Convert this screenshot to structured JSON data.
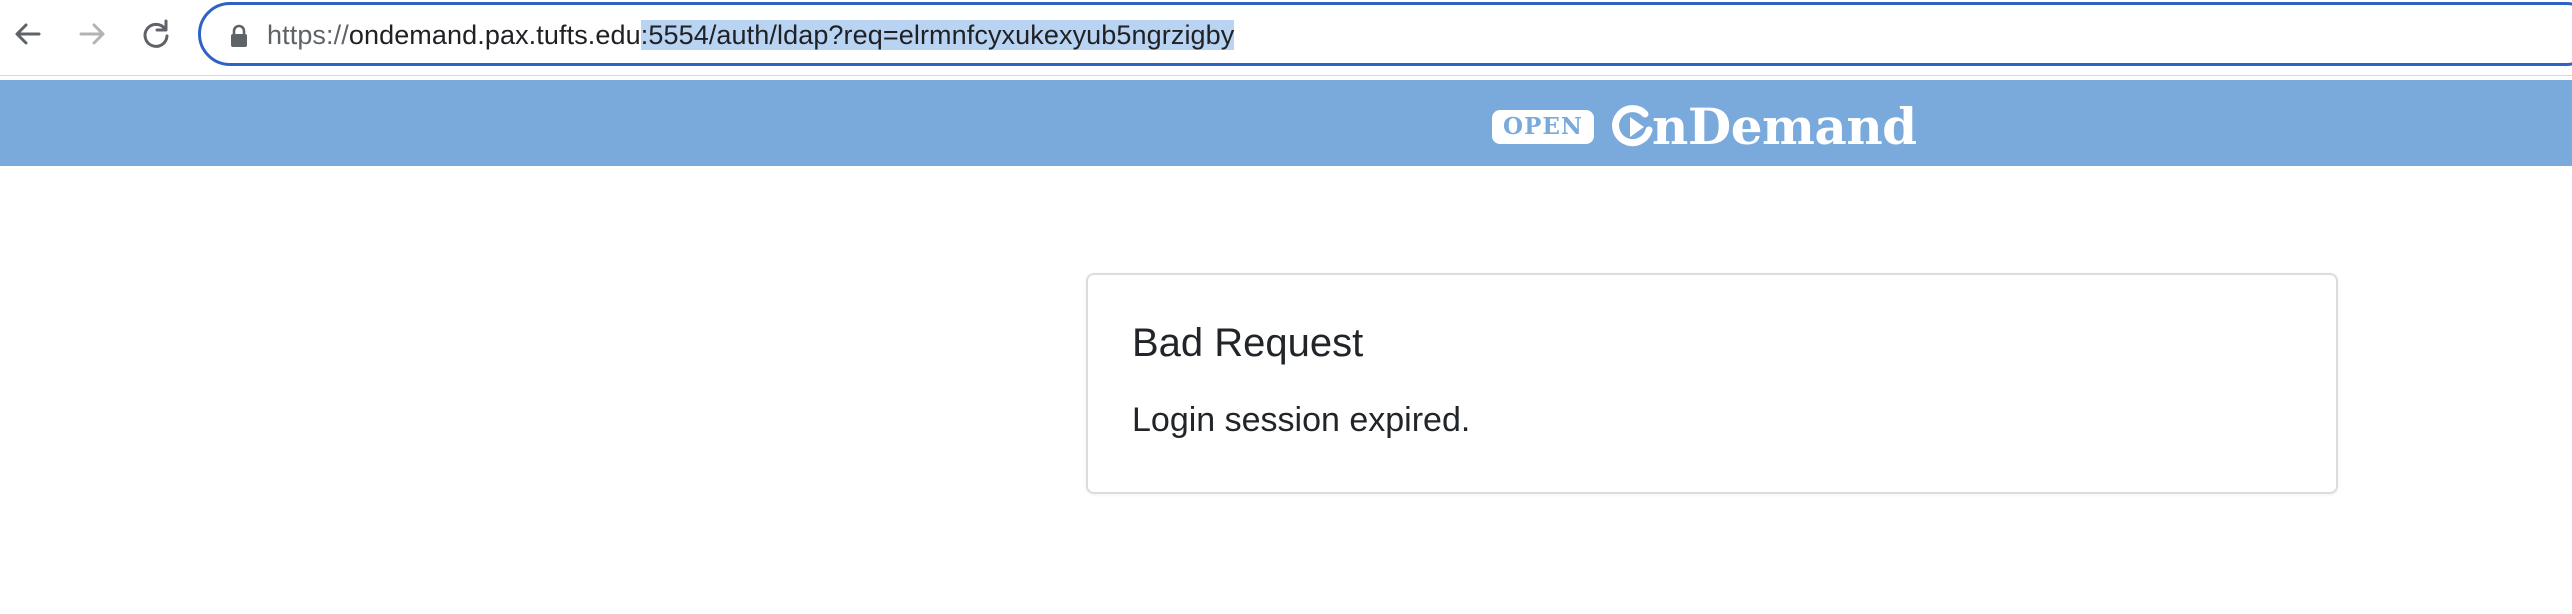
{
  "browser": {
    "url_scheme": "https://",
    "url_host": "ondemand.pax.tufts.edu",
    "url_selected": ":5554/auth/ldap?req=elrmnfcyxukexyub5ngrzigby",
    "icons": {
      "back": "back-arrow-icon",
      "forward": "forward-arrow-icon",
      "reload": "reload-icon",
      "lock": "lock-icon"
    }
  },
  "header": {
    "badge": "OPEN",
    "logo_text": "nDemand",
    "bar_color": "#7aa9dc"
  },
  "error": {
    "title": "Bad Request",
    "message": "Login session expired."
  }
}
